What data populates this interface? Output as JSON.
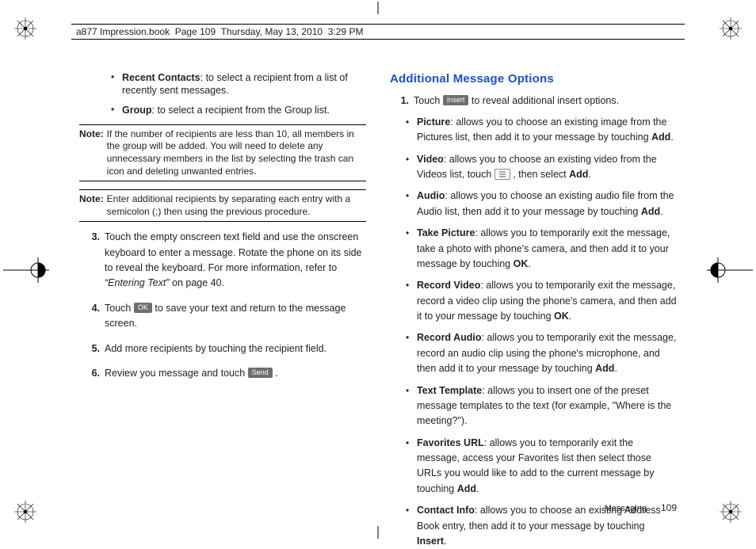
{
  "header": "a877 Impression.book  Page 109  Thursday, May 13, 2010  3:29 PM",
  "left": {
    "bullets": [
      {
        "term": "Recent Contacts",
        "rest": ": to select a recipient from a list of recently sent messages."
      },
      {
        "term": "Group",
        "rest": ": to select a recipient from the Group list."
      }
    ],
    "note1_label": "Note:",
    "note1_text": "If the number of recipients are less than 10, all members in the group will be added. You will need to delete any unnecessary members in the list by selecting the trash can icon and deleting unwanted entries.",
    "note2_label": "Note:",
    "note2_text": "Enter additional recipients by separating each entry with a semicolon (;) then using the previous procedure.",
    "step3_num": "3.",
    "step3": "Touch the empty onscreen text field and use the onscreen keyboard to enter a message. Rotate the phone on its side to reveal the keyboard. For more information, refer to ",
    "step3_ref": "“Entering Text”",
    "step3_tail": "  on page 40.",
    "step4_num": "4.",
    "step4_a": "Touch  ",
    "step4_pill": "OK",
    "step4_b": "  to save your text and return to the message screen.",
    "step5_num": "5.",
    "step5": "Add more recipients by touching the recipient field.",
    "step6_num": "6.",
    "step6_a": "Review you message and touch  ",
    "step6_pill": "Send",
    "step6_b": " ."
  },
  "right": {
    "heading": "Additional Message Options",
    "step1_num": "1.",
    "step1_a": "Touch  ",
    "step1_pill": "Insert",
    "step1_b": "  to reveal additional insert options.",
    "items": [
      {
        "term": "Picture",
        "rest": ": allows you to choose an existing image from the Pictures list, then add it to your message by touching ",
        "bold": "Add",
        "tail": "."
      },
      {
        "term": "Video",
        "rest": ": allows you to choose an existing video from the Videos list, touch  ",
        "icon": true,
        "rest2": " , then select ",
        "bold": "Add",
        "tail": "."
      },
      {
        "term": "Audio",
        "rest": ": allows you to choose an existing audio file from the Audio list, then add it to your message by touching ",
        "bold": "Add",
        "tail": "."
      },
      {
        "term": "Take Picture",
        "rest": ": allows you to temporarily exit the message, take a photo with phone's camera, and then add it to your message by touching ",
        "bold": "OK",
        "tail": "."
      },
      {
        "term": "Record Video",
        "rest": ": allows you to temporarily exit the message, record a video clip using the phone's camera, and then add it to your message by touching ",
        "bold": "OK",
        "tail": "."
      },
      {
        "term": "Record Audio",
        "rest": ": allows you to temporarily exit the message, record an audio clip using the phone's microphone, and then add it to your message by touching ",
        "bold": "Add",
        "tail": "."
      },
      {
        "term": "Text Template",
        "rest": ": allows you to insert one of the preset message templates to the text (for example, \"Where is the meeting?\")."
      },
      {
        "term": "Favorites URL",
        "rest": ": allows you to temporarily exit the message, access your Favorites list then select those URLs you would like to add to the current message by touching ",
        "bold": "Add",
        "tail": "."
      },
      {
        "term": "Contact Info",
        "rest": ": allows you to choose an existing Address Book entry, then add it to your message by touching ",
        "bold": "Insert",
        "tail": "."
      }
    ]
  },
  "footer": {
    "section": "Messaging",
    "page": "109"
  }
}
